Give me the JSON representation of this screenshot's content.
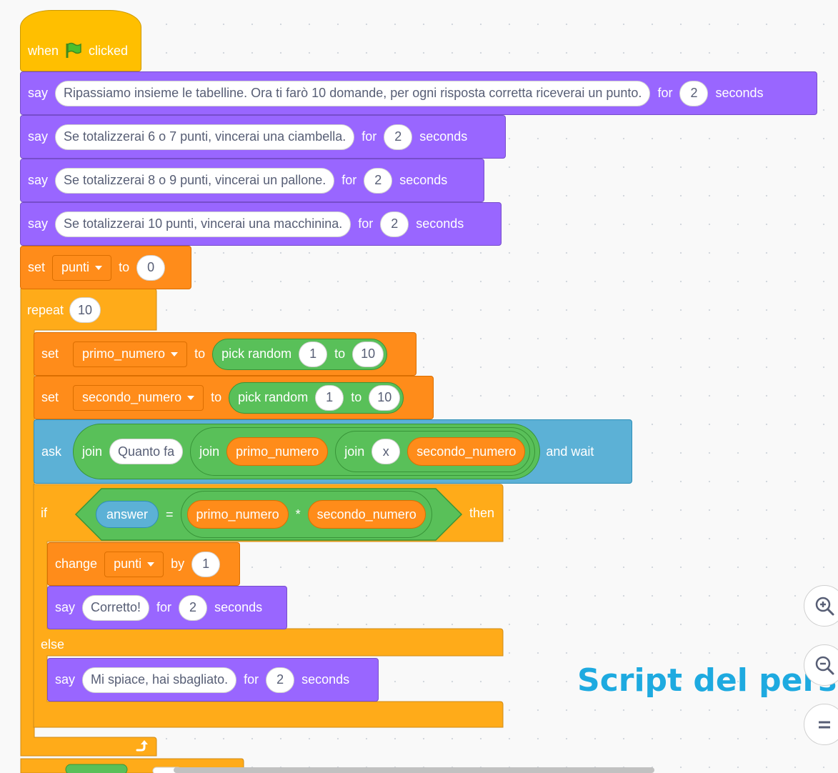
{
  "workspace": {
    "hat": {
      "when": "when",
      "clicked": "clicked"
    },
    "intro_blocks": [
      {
        "cmd": "say",
        "message": "Ripassiamo insieme le tabelline. Ora ti farò 10 domande, per ogni risposta corretta riceverai un punto.",
        "for": "for",
        "secs": "2",
        "unit": "seconds"
      },
      {
        "cmd": "say",
        "message": "Se totalizzerai 6 o 7 punti, vincerai una ciambella.",
        "for": "for",
        "secs": "2",
        "unit": "seconds"
      },
      {
        "cmd": "say",
        "message": "Se totalizzerai 8 o 9 punti, vincerai un pallone.",
        "for": "for",
        "secs": "2",
        "unit": "seconds"
      },
      {
        "cmd": "say",
        "message": "Se totalizzerai 10 punti, vincerai una macchinina.",
        "for": "for",
        "secs": "2",
        "unit": "seconds"
      }
    ],
    "set_punti": {
      "cmd": "set",
      "var": "punti",
      "to": "to",
      "value": "0"
    },
    "repeat": {
      "cmd": "repeat",
      "count": "10"
    },
    "set_primo": {
      "cmd": "set",
      "var": "primo_numero",
      "to": "to",
      "op": "pick random",
      "from": "1",
      "op_to": "to",
      "max": "10"
    },
    "set_secondo": {
      "cmd": "set",
      "var": "secondo_numero",
      "to": "to",
      "op": "pick random",
      "from": "1",
      "op_to": "to",
      "max": "10"
    },
    "ask": {
      "cmd": "ask",
      "join": "join",
      "text": "Quanto fa",
      "var1": "primo_numero",
      "x": "x",
      "var2": "secondo_numero",
      "and_wait": "and wait"
    },
    "if_block": {
      "cmd": "if",
      "answer": "answer",
      "eq": "=",
      "var1": "primo_numero",
      "mul": "*",
      "var2": "secondo_numero",
      "then": "then",
      "else": "else"
    },
    "change": {
      "cmd": "change",
      "var": "punti",
      "by": "by",
      "value": "1"
    },
    "say_correct": {
      "cmd": "say",
      "message": "Corretto!",
      "for": "for",
      "secs": "2",
      "unit": "seconds"
    },
    "say_wrong": {
      "cmd": "say",
      "message": "Mi spiace, hai sbagliato.",
      "for": "for",
      "secs": "2",
      "unit": "seconds"
    }
  },
  "overlay_title": "Script del perso",
  "icons": {
    "flag": "green-flag-icon",
    "repeat_arrow": "loop-arrow-icon",
    "zoom_in": "zoom-in-icon",
    "zoom_out": "zoom-out-icon",
    "reset": "zoom-reset-icon"
  },
  "colors": {
    "looks": "#9966ff",
    "variables": "#ff8c1a",
    "control": "#ffab19",
    "events": "#ffbf00",
    "operators": "#59c059",
    "sensing": "#5cb1d6",
    "overlay_text": "#1eaae0"
  }
}
